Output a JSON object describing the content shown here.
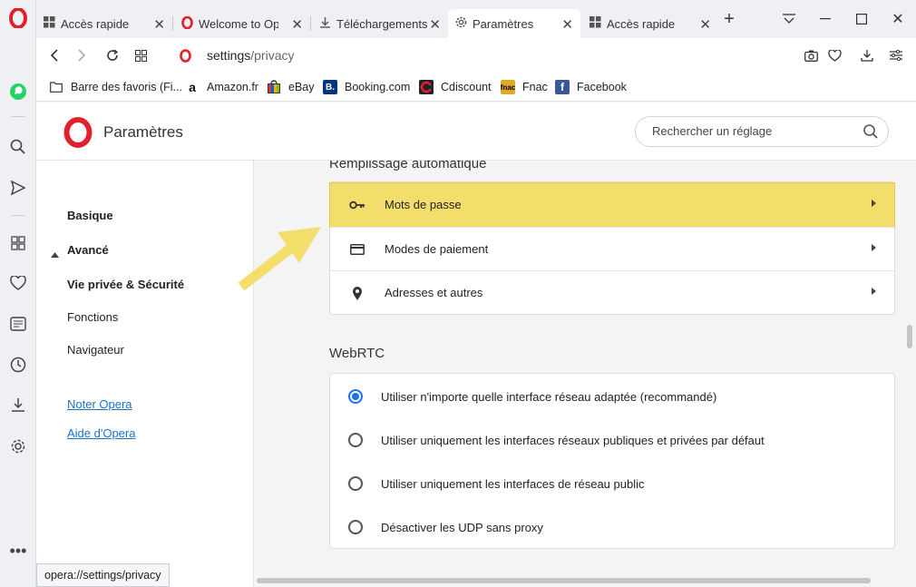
{
  "tabs": [
    {
      "title": "Accès rapide",
      "icon": "grid-icon",
      "active": false
    },
    {
      "title": "Welcome to Opera",
      "icon": "opera-icon",
      "active": false
    },
    {
      "title": "Téléchargements",
      "icon": "download-icon",
      "active": false
    },
    {
      "title": "Paramètres",
      "icon": "gear-icon",
      "active": true
    },
    {
      "title": "Accès rapide",
      "icon": "grid-icon",
      "active": false
    }
  ],
  "address": {
    "host": "settings",
    "path": "/privacy"
  },
  "bookmarks": [
    {
      "label": "Barre des favoris (Fi...",
      "icon": "folder-icon"
    },
    {
      "label": "Amazon.fr",
      "icon": "amazon-icon"
    },
    {
      "label": "eBay",
      "icon": "ebay-icon"
    },
    {
      "label": "Booking.com",
      "icon": "booking-icon"
    },
    {
      "label": "Cdiscount",
      "icon": "cdiscount-icon"
    },
    {
      "label": "Fnac",
      "icon": "fnac-icon"
    },
    {
      "label": "Facebook",
      "icon": "facebook-icon"
    }
  ],
  "header": {
    "title": "Paramètres",
    "search_placeholder": "Rechercher un réglage"
  },
  "nav": {
    "basic": "Basique",
    "advanced": "Avancé",
    "items": [
      "Vie privée & Sécurité",
      "Fonctions",
      "Navigateur"
    ],
    "links": [
      "Noter Opera",
      "Aide d'Opera"
    ]
  },
  "autofill": {
    "title": "Remplissage automatique",
    "rows": [
      {
        "label": "Mots de passe",
        "icon": "key-icon"
      },
      {
        "label": "Modes de paiement",
        "icon": "card-icon"
      },
      {
        "label": "Adresses et autres",
        "icon": "location-pin-icon"
      }
    ]
  },
  "webrtc": {
    "title": "WebRTC",
    "options": [
      {
        "label": "Utiliser n'importe quelle interface réseau adaptée (recommandé)",
        "checked": true
      },
      {
        "label": "Utiliser uniquement les interfaces réseaux publiques et privées par défaut",
        "checked": false
      },
      {
        "label": "Utiliser uniquement les interfaces de réseau public",
        "checked": false
      },
      {
        "label": "Désactiver les UDP sans proxy",
        "checked": false
      }
    ]
  },
  "status_url": "opera://settings/privacy",
  "colors": {
    "highlight": "#f3de6c",
    "opera_red": "#e0202c",
    "link": "#1a73c9",
    "radio_accent": "#1a73e8"
  }
}
